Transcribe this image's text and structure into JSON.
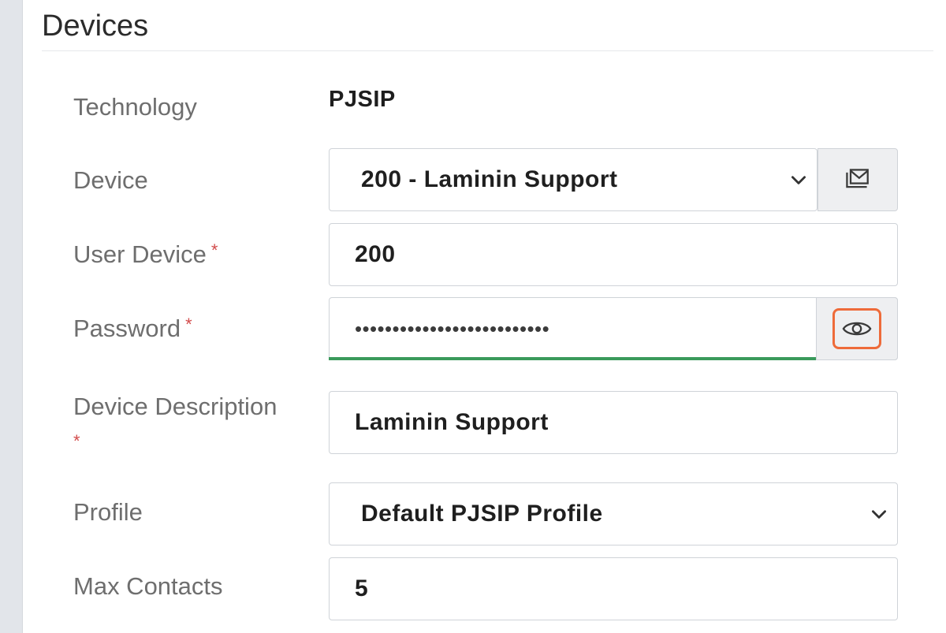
{
  "panel": {
    "title": "Devices"
  },
  "form": {
    "technology": {
      "label": "Technology",
      "value": "PJSIP"
    },
    "device": {
      "label": "Device",
      "value": "200 - Laminin Support",
      "addon_icon": "mail-icon"
    },
    "user_device": {
      "label": "User Device",
      "required_mark": "*",
      "value": "200"
    },
    "password": {
      "label": "Password",
      "required_mark": "*",
      "masked_value": "••••••••••••••••••••••••••",
      "toggle_icon": "eye-icon"
    },
    "device_description": {
      "label": "Device Description",
      "required_mark": "*",
      "value": "Laminin Support"
    },
    "profile": {
      "label": "Profile",
      "value": "Default PJSIP Profile"
    },
    "max_contacts": {
      "label": "Max Contacts",
      "value": "5"
    }
  },
  "colors": {
    "required": "#d24b4b",
    "focus_underline": "#3a9a5b",
    "highlight_frame": "#ee6b3a"
  }
}
